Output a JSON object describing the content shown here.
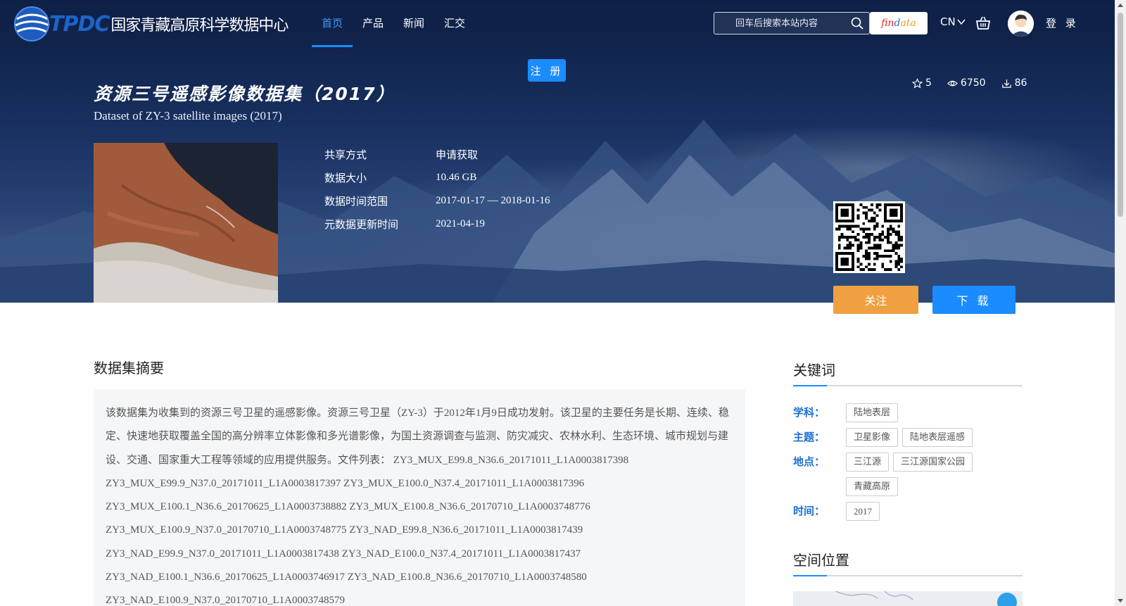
{
  "header": {
    "logo_en": "TPDC",
    "logo_cn": "国家青藏高原科学数据中心",
    "nav": [
      {
        "label": "首页",
        "active": true
      },
      {
        "label": "产品",
        "active": false
      },
      {
        "label": "新闻",
        "active": false
      },
      {
        "label": "汇交",
        "active": false
      }
    ],
    "search_placeholder": "回车后搜索本站内容",
    "findata": {
      "f1": "fin",
      "f2": "d",
      "f3": "ata"
    },
    "lang": "CN",
    "login": "登 录",
    "register": "注 册"
  },
  "dataset": {
    "title_cn": "资源三号遥感影像数据集（2017）",
    "title_en": "Dataset of ZY-3 satellite images (2017)",
    "stats": {
      "stars": "5",
      "views": "6750",
      "downloads": "86"
    },
    "meta": [
      {
        "label": "共享方式",
        "value": "申请获取"
      },
      {
        "label": "数据大小",
        "value": "10.46 GB"
      },
      {
        "label": "数据时间范围",
        "value": "2017-01-17 — 2018-01-16"
      },
      {
        "label": "元数据更新时间",
        "value": "2021-04-19"
      }
    ],
    "follow_label": "关注",
    "download_label": "下 载"
  },
  "abstract": {
    "title": "数据集摘要",
    "text": "该数据集为收集到的资源三号卫星的遥感影像。资源三号卫星（ZY-3）于2012年1月9日成功发射。该卫星的主要任务是长期、连续、稳定、快速地获取覆盖全国的高分辨率立体影像和多光谱影像，为国土资源调查与监测、防灾减灾、农林水利、生态环境、城市规划与建设、交通、国家重大工程等领域的应用提供服务。文件列表： ZY3_MUX_E99.8_N36.6_20171011_L1A0003817398 ZY3_MUX_E99.9_N37.0_20171011_L1A0003817397 ZY3_MUX_E100.0_N37.4_20171011_L1A0003817396 ZY3_MUX_E100.1_N36.6_20170625_L1A0003738882 ZY3_MUX_E100.8_N36.6_20170710_L1A0003748776 ZY3_MUX_E100.9_N37.0_20170710_L1A0003748775 ZY3_NAD_E99.8_N36.6_20171011_L1A0003817439 ZY3_NAD_E99.9_N37.0_20171011_L1A0003817438 ZY3_NAD_E100.0_N37.4_20171011_L1A0003817437 ZY3_NAD_E100.1_N36.6_20170625_L1A0003746917 ZY3_NAD_E100.8_N36.6_20170710_L1A0003748580 ZY3_NAD_E100.9_N37.0_20170710_L1A0003748579"
  },
  "keywords": {
    "title": "关键词",
    "groups": [
      {
        "label": "学科：",
        "tags": [
          "陆地表层"
        ]
      },
      {
        "label": "主题：",
        "tags": [
          "卫星影像",
          "陆地表层遥感"
        ]
      },
      {
        "label": "地点：",
        "tags": [
          "三江源",
          "三江源国家公园",
          "青藏高原"
        ]
      },
      {
        "label": "时间：",
        "tags": [
          "2017"
        ]
      }
    ]
  },
  "location": {
    "title": "空间位置"
  },
  "colors": {
    "accent": "#1a8cff",
    "follow": "#f0a040",
    "keyword_label": "#1a6fd6"
  }
}
